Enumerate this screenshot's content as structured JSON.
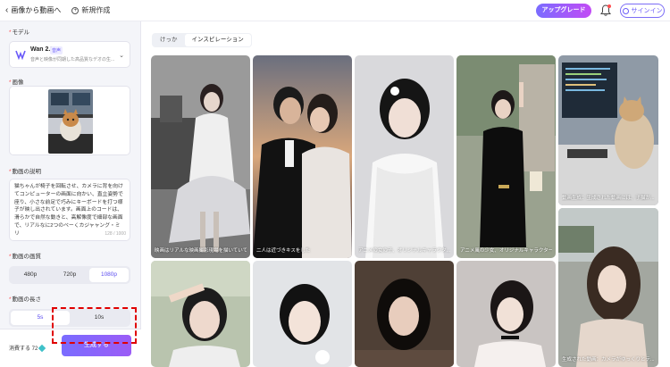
{
  "topbar": {
    "back_label": "画像から動画へ",
    "new_label": "新規作成",
    "upgrade_label": "アップグレード",
    "signin_label": "サインイン"
  },
  "left": {
    "model_label": "モデル",
    "model_name": "Wan 2.5",
    "model_badge": "音声",
    "model_desc": "音声と映像が同期した高品質なデオの生...",
    "image_label": "画像",
    "desc_label": "動画の説明",
    "desc_text": "猫ちゃんが椅子を回転させ、カメラに背を向けてコンピューターの画面に向かい、直立姿勢で座り、小さな前足で巧みにキーボードを打つ様子が映し出されています。画面上のコードは、滑らかで自然な動きと、高解像度で細部な画面で、リアルなに2つのベーくカジャャング・ミリ",
    "desc_count": "128 / 1000",
    "quality_label": "動画の画質",
    "quality_options": [
      "480p",
      "720p",
      "1080p"
    ],
    "length_label": "動画の長さ",
    "length_options": [
      "5s",
      "10s"
    ],
    "consume_label": "消費する 72",
    "generate_label": "生成する"
  },
  "right": {
    "tabs": [
      "けっか",
      "インスピレーション"
    ],
    "captions": {
      "c1": "映画はリアルな映画撮影現場を描いていて...",
      "c2": "二人は近づきキスをした",
      "c3": "アニメの女の子、オリジナルキャラクタ...",
      "c4": "アニメ風の少女、オリジナルキャラクター...",
      "c5": "動画生成：生成された動画には、子猫が...",
      "c6": "生成された動画：カメラがゆっくりとテ..."
    }
  },
  "colors": {
    "accent": "#6a5af9",
    "highlight_dashed": "#e00000"
  }
}
